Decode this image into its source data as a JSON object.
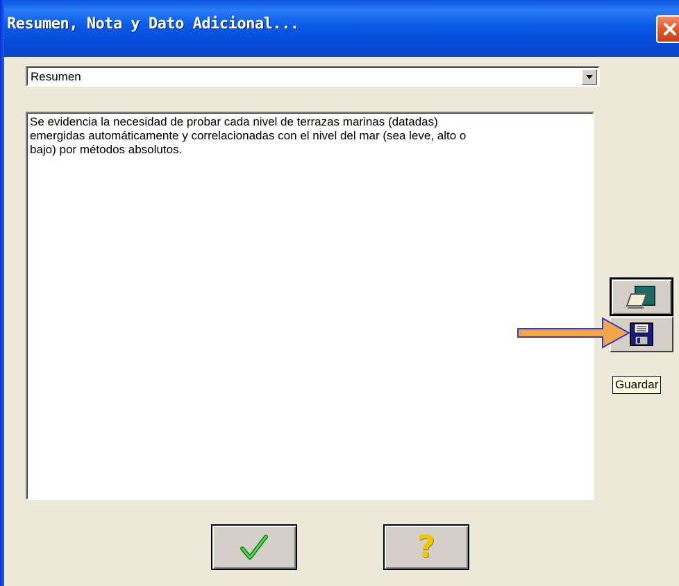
{
  "window": {
    "title": "Resumen, Nota y Dato Adicional...",
    "close_icon": "close-icon"
  },
  "selector": {
    "value": "Resumen",
    "arrow_icon": "chevron-down-icon"
  },
  "content": {
    "text": "Se evidencia la necesidad de probar cada nivel de terrazas marinas (datadas)\nemergidas automáticamente y correlacionadas con el nivel del mar (sea leve, alto o\nbajo) por métodos absolutos."
  },
  "side_toolbar": {
    "erase_icon": "eraser-icon",
    "save_icon": "floppy-disk-icon",
    "save_tooltip": "Guardar"
  },
  "footer": {
    "ok_icon": "checkmark-icon",
    "help_icon": "question-mark-icon",
    "help_glyph": "?"
  },
  "annotation": {
    "arrow_color": "#f4a64a"
  },
  "colors": {
    "title_bar": "#0a5ae8",
    "dialog_bg": "#ece9d8",
    "button_face": "#d4d0c8",
    "tooltip_bg": "#ffffe1",
    "check_green": "#2ab32a",
    "question_yellow": "#f5c400",
    "close_red": "#e15a2c"
  }
}
